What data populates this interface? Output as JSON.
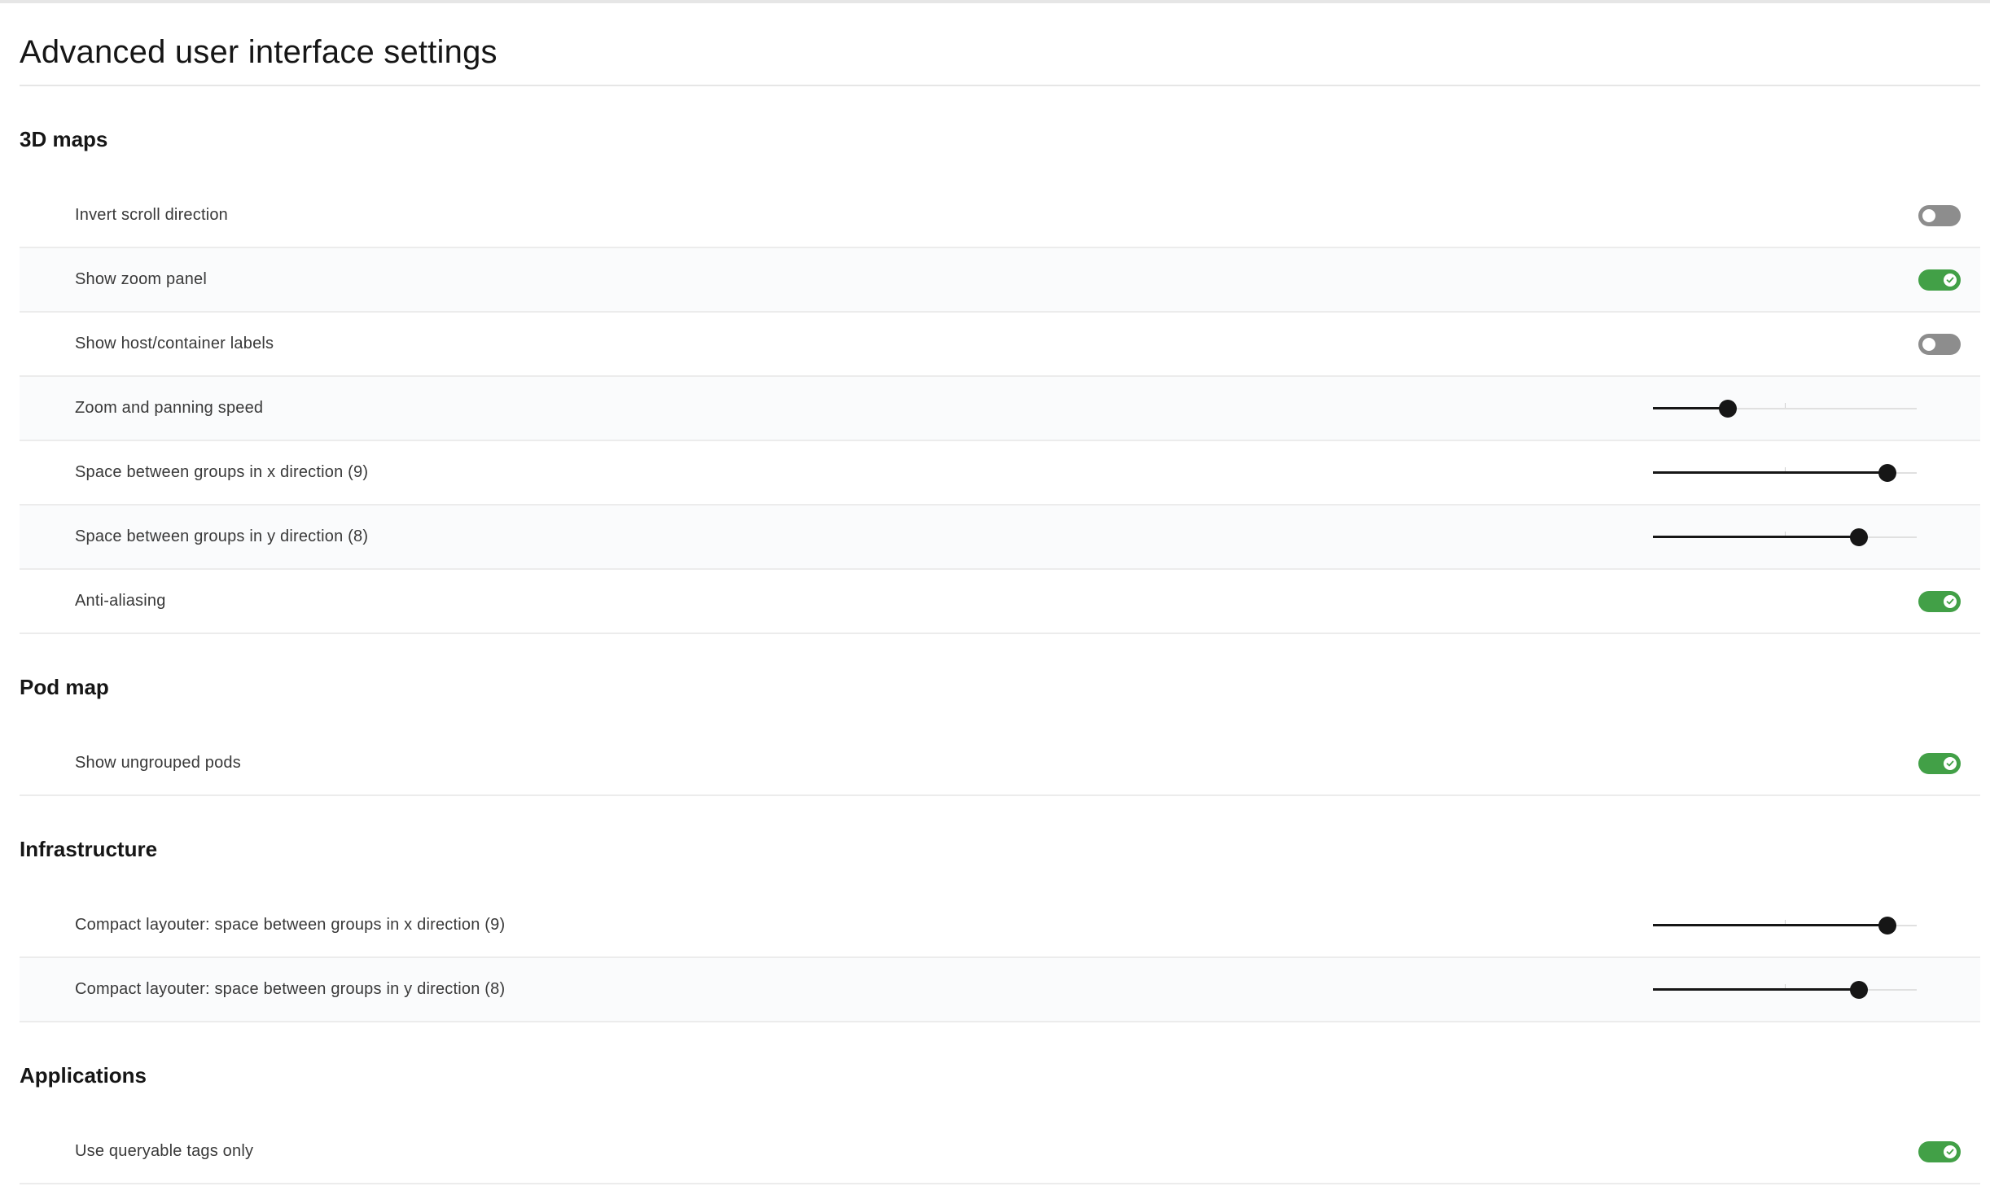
{
  "page": {
    "title": "Advanced user interface settings"
  },
  "colors": {
    "toggle_on": "#42a047",
    "toggle_off": "#8d8d8d",
    "slider_fill": "#161616"
  },
  "sections": {
    "maps3d": {
      "title": "3D maps",
      "invert_scroll": {
        "label": "Invert scroll direction",
        "enabled": false
      },
      "zoom_panel": {
        "label": "Show zoom panel",
        "enabled": true
      },
      "host_labels": {
        "label": "Show host/container labels",
        "enabled": false
      },
      "zoom_speed": {
        "label": "Zoom and panning speed",
        "fraction": 0.285
      },
      "space_x": {
        "label": "Space between groups in x direction (9)",
        "fraction": 0.89
      },
      "space_y": {
        "label": "Space between groups in y direction (8)",
        "fraction": 0.78
      },
      "anti_aliasing": {
        "label": "Anti-aliasing",
        "enabled": true
      }
    },
    "podmap": {
      "title": "Pod map",
      "ungrouped_pods": {
        "label": "Show ungrouped pods",
        "enabled": true
      }
    },
    "infrastructure": {
      "title": "Infrastructure",
      "compact_x": {
        "label": "Compact layouter: space between groups in x direction (9)",
        "fraction": 0.89
      },
      "compact_y": {
        "label": "Compact layouter: space between groups in y direction (8)",
        "fraction": 0.78
      }
    },
    "applications": {
      "title": "Applications",
      "queryable_tags": {
        "label": "Use queryable tags only",
        "enabled": true
      }
    }
  }
}
